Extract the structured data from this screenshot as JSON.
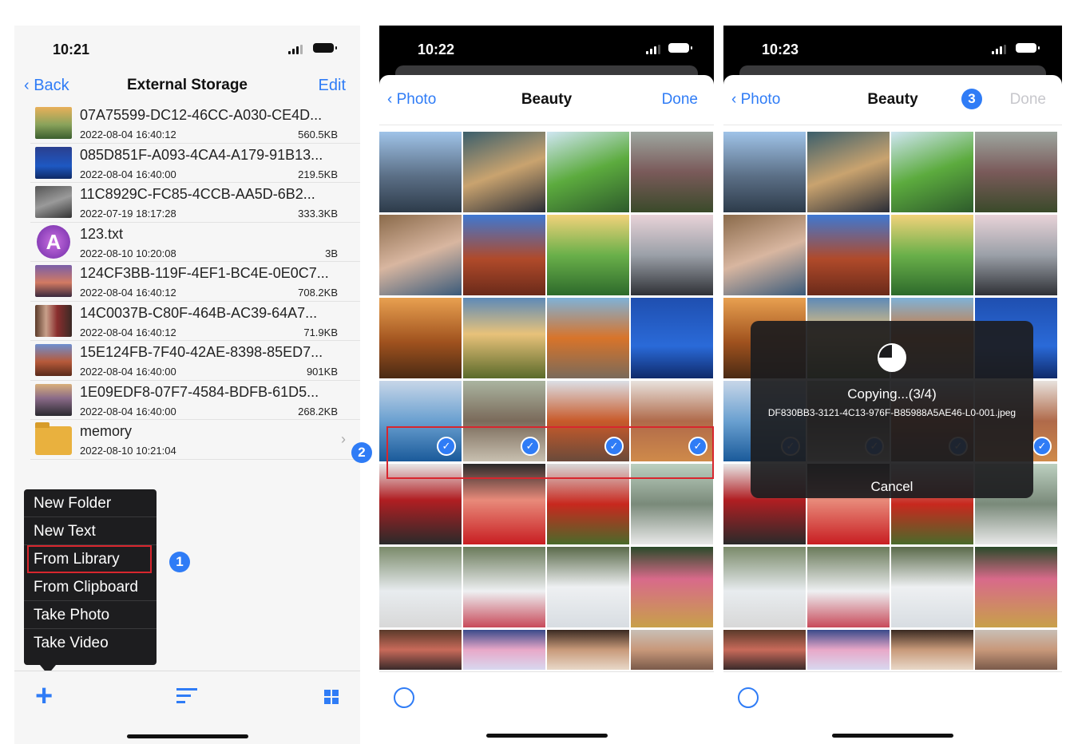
{
  "panel1": {
    "time": "10:21",
    "nav": {
      "back": "Back",
      "title": "External Storage",
      "edit": "Edit"
    },
    "files": [
      {
        "name": "07A75599-DC12-46CC-A030-CE4D...",
        "date": "2022-08-04 16:40:12",
        "size": "560.5KB",
        "thumb": "landscape"
      },
      {
        "name": "085D851F-A093-4CA4-A179-91B13...",
        "date": "2022-08-04 16:40:00",
        "size": "219.5KB",
        "thumb": "sea"
      },
      {
        "name": "11C8929C-FC85-4CCB-AA5D-6B2...",
        "date": "2022-07-19 18:17:28",
        "size": "333.3KB",
        "thumb": "keyboard"
      },
      {
        "name": "123.txt",
        "date": "2022-08-10 10:20:08",
        "size": "3B",
        "thumb": "txt-app"
      },
      {
        "name": "124CF3BB-119F-4EF1-BC4E-0E0C7...",
        "date": "2022-08-04 16:40:12",
        "size": "708.2KB",
        "thumb": "sunset"
      },
      {
        "name": "14C0037B-C80F-464B-AC39-64A7...",
        "date": "2022-08-04 16:40:12",
        "size": "71.9KB",
        "thumb": "people"
      },
      {
        "name": "15E124FB-7F40-42AE-8398-85ED7...",
        "date": "2022-08-04 16:40:00",
        "size": "901KB",
        "thumb": "arch"
      },
      {
        "name": "1E09EDF8-07F7-4584-BDFB-61D5...",
        "date": "2022-08-04 16:40:00",
        "size": "268.2KB",
        "thumb": "road"
      },
      {
        "name": "memory",
        "date": "2022-08-10 10:21:04",
        "size": "",
        "thumb": "folder"
      }
    ],
    "menu": [
      "New Folder",
      "New Text",
      "From Library",
      "From Clipboard",
      "Take Photo",
      "Take Video"
    ],
    "badge": "1",
    "toolbar_icons": [
      "plus-icon",
      "sort-icon",
      "grid-view-icon"
    ]
  },
  "badge2": "2",
  "panel2": {
    "time": "10:22",
    "nav": {
      "back": "Photo",
      "title": "Beauty",
      "done": "Done"
    }
  },
  "panel3": {
    "time": "10:23",
    "nav": {
      "back": "Photo",
      "title": "Beauty",
      "done": "Done"
    },
    "badge": "3",
    "hud": {
      "status": "Copying...(3/4)",
      "filename": "DF830BB3-3121-4C13-976F-B85988A5AE46-L0-001.jpeg",
      "cancel": "Cancel",
      "progress": 0.75
    }
  },
  "colors": {
    "accent": "#2f7cf6",
    "highlight": "#d8262e",
    "menu_bg": "#1d1d1f"
  }
}
